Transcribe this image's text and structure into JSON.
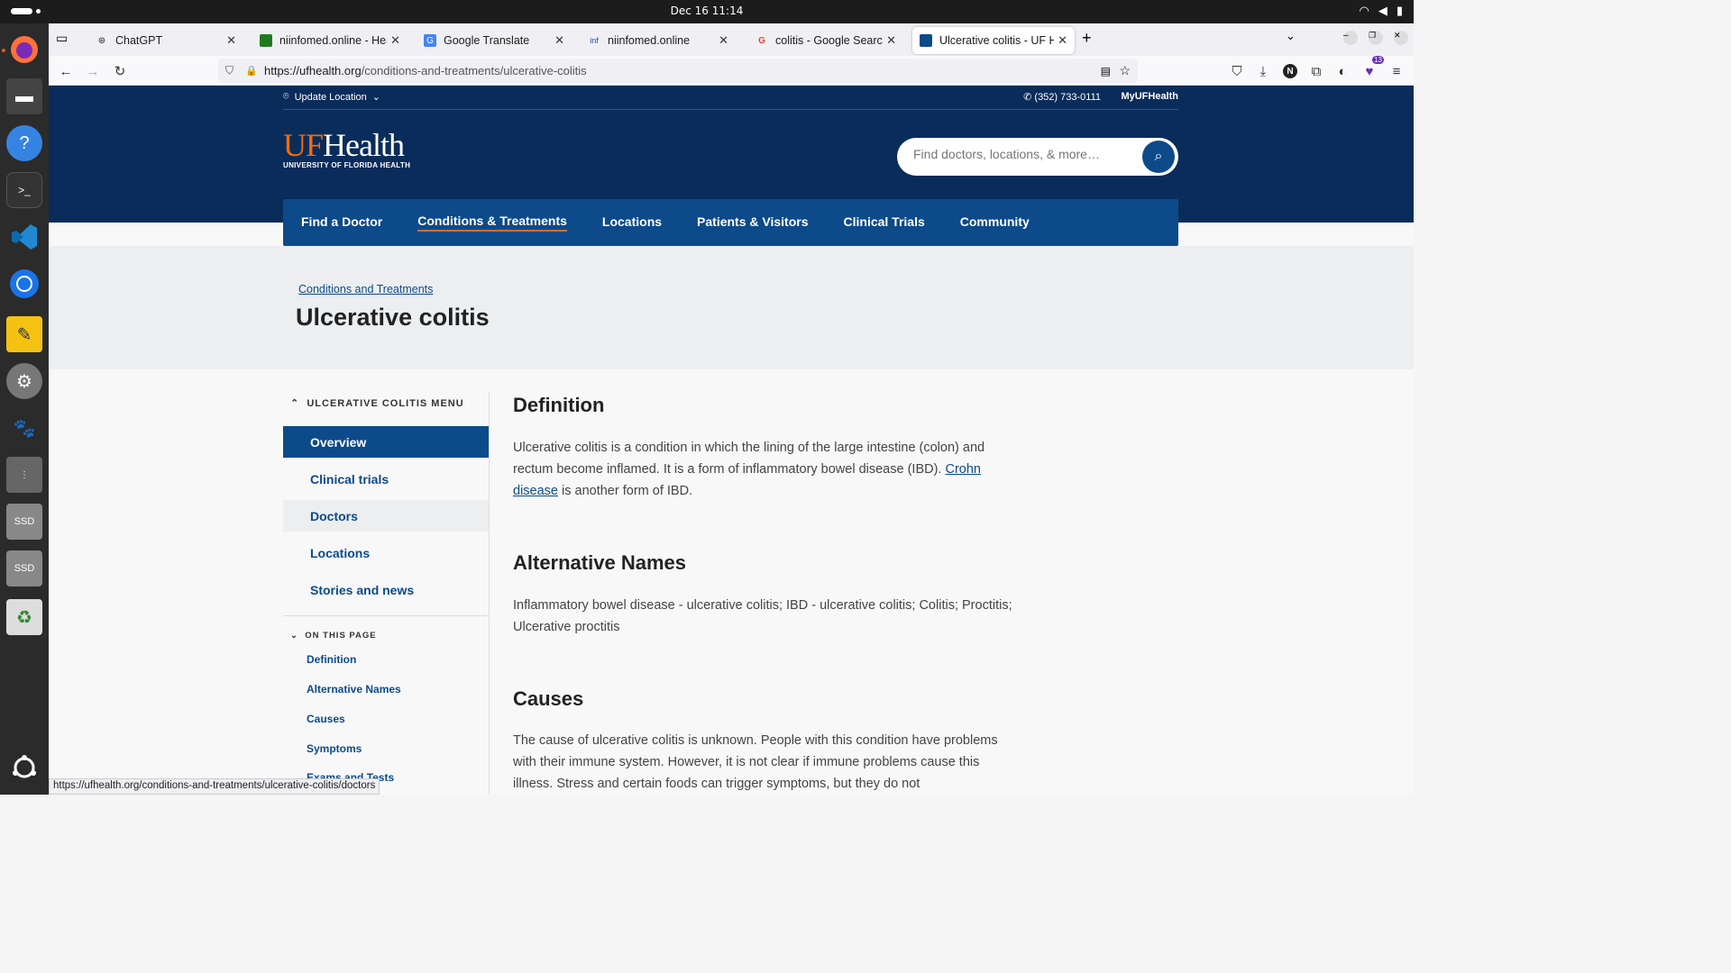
{
  "system": {
    "clock": "Dec 16  11:14"
  },
  "browser": {
    "tabs": [
      {
        "title": "ChatGPT"
      },
      {
        "title": "niinfomed.online - Healt"
      },
      {
        "title": "Google Translate"
      },
      {
        "title": "niinfomed.online"
      },
      {
        "title": "colitis - Google Search"
      },
      {
        "title": "Ulcerative colitis - UF He"
      }
    ],
    "url_domain": "https://ufhealth.org",
    "url_path": "/conditions-and-treatments/ulcerative-colitis",
    "status_url": "https://ufhealth.org/conditions-and-treatments/ulcerative-colitis/doctors",
    "extension_badge": "13"
  },
  "site": {
    "update_location": "Update Location",
    "phone": "(352) 733-0111",
    "my_account": "MyUFHealth",
    "logo_uf": "UF",
    "logo_health": "Health",
    "logo_sub": "UNIVERSITY OF FLORIDA HEALTH",
    "search_placeholder": "Find doctors, locations, & more…",
    "nav": [
      "Find a Doctor",
      "Conditions & Treatments",
      "Locations",
      "Patients & Visitors",
      "Clinical Trials",
      "Community"
    ],
    "breadcrumb": "Conditions and Treatments",
    "title": "Ulcerative colitis"
  },
  "sidebar": {
    "menu_heading": "ULCERATIVE COLITIS MENU",
    "items": [
      "Overview",
      "Clinical trials",
      "Doctors",
      "Locations",
      "Stories and news"
    ],
    "on_this_page": "ON THIS PAGE",
    "toc": [
      "Definition",
      "Alternative Names",
      "Causes",
      "Symptoms",
      "Exams and Tests"
    ]
  },
  "article": {
    "definition_heading": "Definition",
    "definition_text": "Ulcerative colitis is a condition in which the lining of the large intestine (colon) and rectum become inflamed. It is a form of inflammatory bowel disease (IBD).",
    "crohn_link": "Crohn disease",
    "crohn_tail": " is another form of IBD.",
    "alt_heading": "Alternative Names",
    "alt_text": "Inflammatory bowel disease - ulcerative colitis; IBD - ulcerative colitis; Colitis; Proctitis; Ulcerative proctitis",
    "causes_heading": "Causes",
    "causes_text": "The cause of ulcerative colitis is unknown. People with this condition have problems with their immune system. However, it is not clear if immune problems cause this illness. Stress and certain foods can trigger symptoms, but they do not"
  }
}
